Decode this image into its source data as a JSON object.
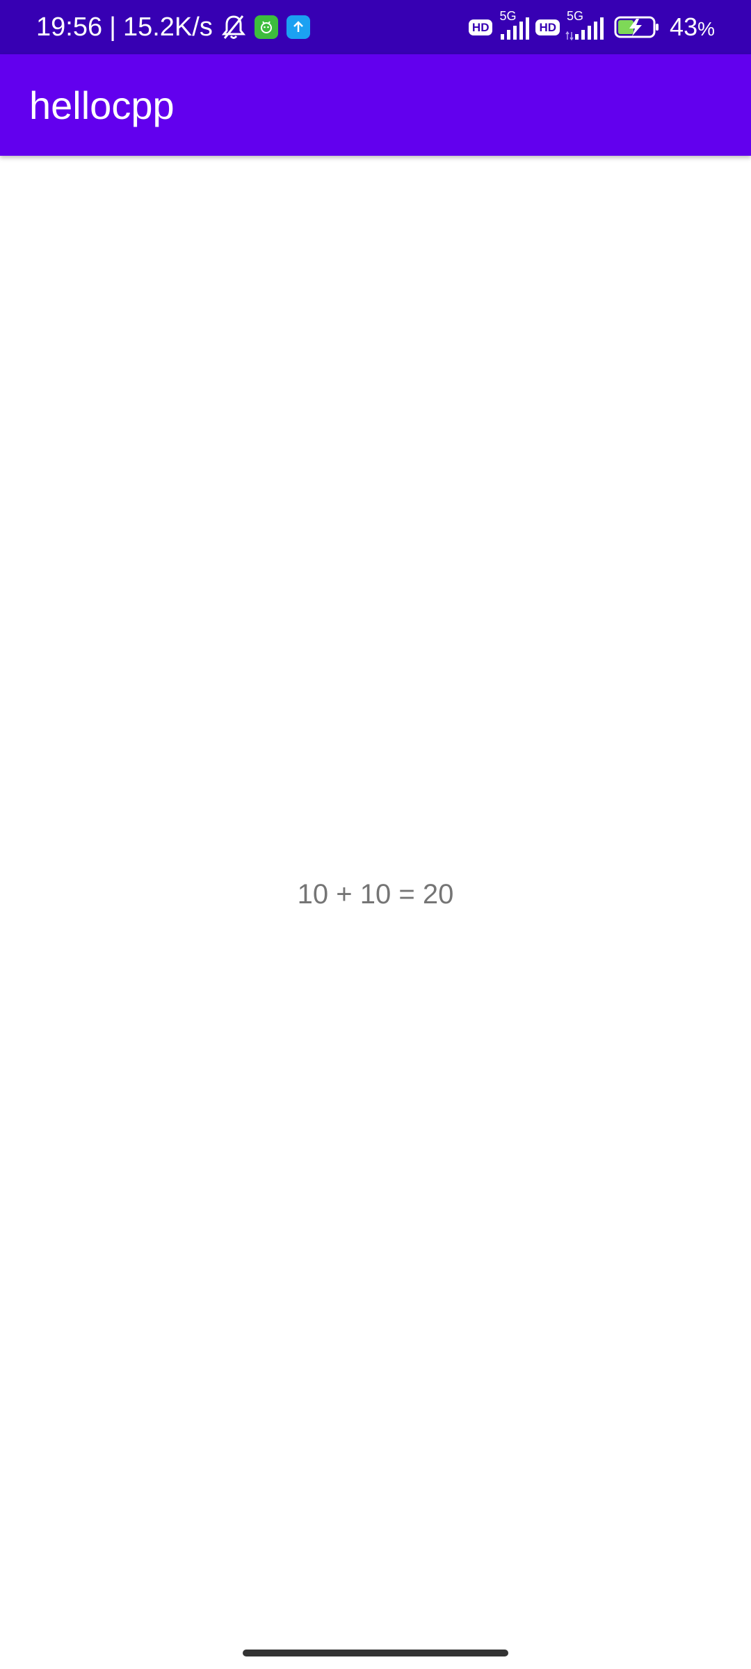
{
  "status_bar": {
    "time": "19:56",
    "separator": "|",
    "net_speed": "15.2K/s",
    "icons": [
      "bell-muted-icon",
      "android-app-icon",
      "upload-app-icon"
    ],
    "sim1": {
      "hd": "HD",
      "network": "5G"
    },
    "sim2": {
      "hd": "HD",
      "network": "5G"
    },
    "battery_percent": "43",
    "battery_unit": "%",
    "background_color": "#3700b3"
  },
  "app_bar": {
    "title": "hellocpp",
    "background_color": "#6200ee"
  },
  "content": {
    "result": "10 + 10 = 20"
  }
}
